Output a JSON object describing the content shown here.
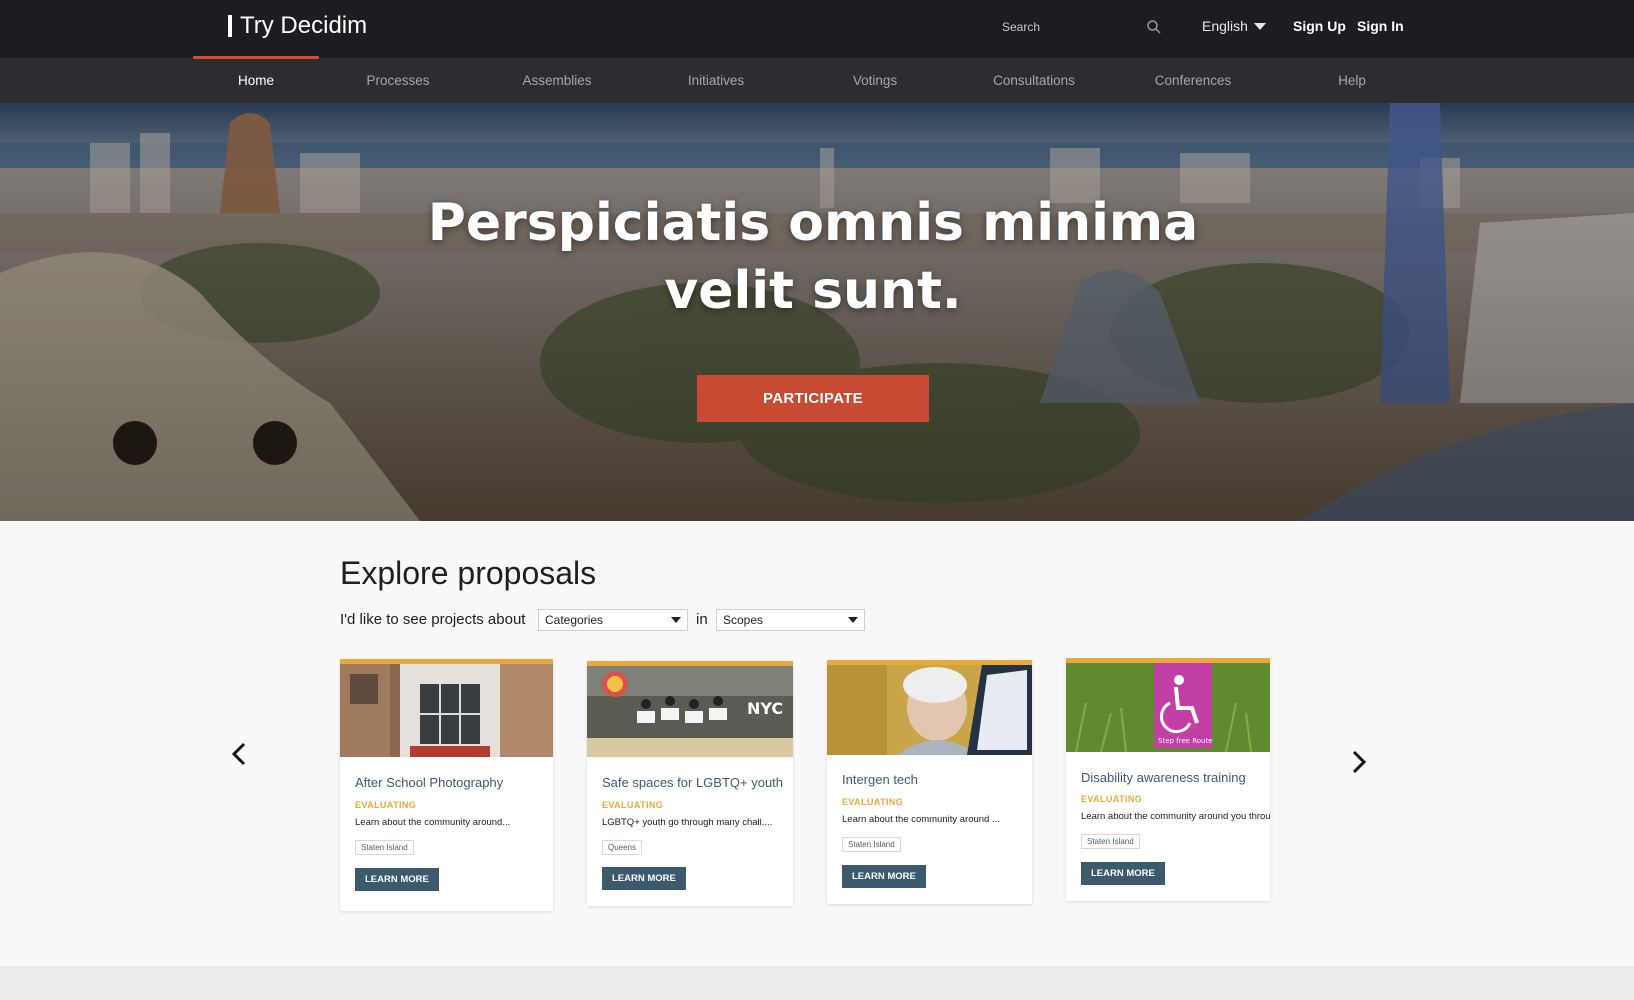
{
  "header": {
    "logo_text": "Try Decidim",
    "search_placeholder": "Search",
    "language": "English",
    "sign_up": "Sign Up",
    "sign_in": "Sign In"
  },
  "nav": {
    "items": [
      "Home",
      "Processes",
      "Assemblies",
      "Initiatives",
      "Votings",
      "Consultations",
      "Conferences",
      "Help"
    ],
    "active": "Home"
  },
  "hero": {
    "title": "Perspiciatis omnis minima velit sunt.",
    "button": "PARTICIPATE"
  },
  "explore": {
    "title": "Explore proposals",
    "filter_prefix": "I'd like to see projects about",
    "category_select": "Categories",
    "in_label": "in",
    "scope_select": "Scopes",
    "cards": [
      {
        "title": "After School Photography",
        "status": "EVALUATING",
        "description": "Learn about the community around...",
        "tag": "Staten Island",
        "button": "LEARN MORE",
        "image": "school-building"
      },
      {
        "title": "Safe spaces for LGBTQ+ youth",
        "status": "EVALUATING",
        "description": "LGBTQ+ youth go through many chall....",
        "tag": "Queens",
        "button": "LEARN MORE",
        "image": "youth-group-with-signs"
      },
      {
        "title": "Intergen tech",
        "status": "EVALUATING",
        "description": "Learn about the community around ...",
        "tag": "Staten Island",
        "button": "LEARN MORE",
        "image": "elderly-woman-laptop"
      },
      {
        "title": "Disability awareness training",
        "status": "EVALUATING",
        "description": "Learn about the community around you throu",
        "tag": "Staten Island",
        "button": "LEARN MORE",
        "image": "accessibility-sign"
      }
    ]
  },
  "colors": {
    "topbar": "#1d1c21",
    "nav": "#2d2d31",
    "accent": "#d24b32",
    "participate": "#c84a32",
    "status": "#e8a93b",
    "card_button": "#3b5a6c",
    "card_title": "#3d5a76"
  }
}
